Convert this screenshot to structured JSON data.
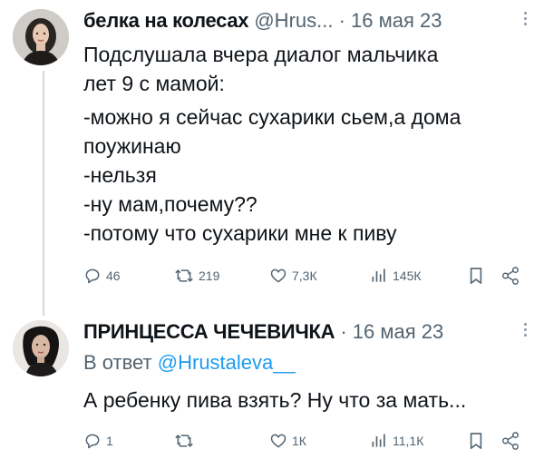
{
  "tweets": [
    {
      "author": "белка на колесах",
      "handle": "@Hrus...",
      "separator": "·",
      "date": "16 мая 23",
      "lines": [
        "Подслушала вчера диалог мальчика",
        "лет 9 с мамой:",
        "-можно я сейчас сухарики сьем,а дома",
        "поужинаю",
        "-нельзя",
        "-ну мам,почему??",
        "-потому что сухарики мне к пиву"
      ],
      "replies_count": "46",
      "retweets_count": "219",
      "likes_count": "7,3К",
      "views_count": "145К"
    },
    {
      "author": "ПРИНЦЕССА ЧЕЧЕВИЧКА",
      "separator": "·",
      "date": "16 мая 23",
      "reply_prefix": "В ответ",
      "reply_handle": "@Hrustaleva__",
      "text": "А ребенку пива взять? Ну что за мать...",
      "replies_count": "1",
      "retweets_count": "",
      "likes_count": "1К",
      "views_count": "11,1К"
    }
  ],
  "icons": [
    "reply-icon",
    "retweet-icon",
    "like-icon",
    "views-icon",
    "bookmark-icon",
    "share-icon",
    "more-icon"
  ],
  "colors": {
    "text": "#0f1419",
    "secondary": "#536471",
    "link": "#1d9bf0",
    "thread_line": "#cfd9de"
  }
}
